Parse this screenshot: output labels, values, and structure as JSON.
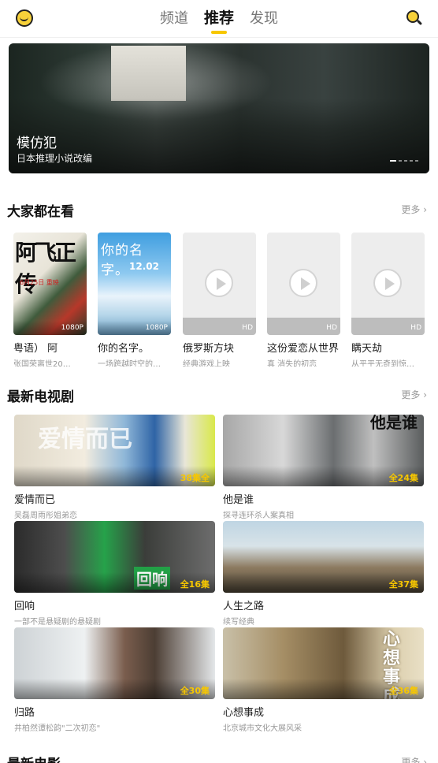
{
  "topbar": {
    "tabs": [
      "频道",
      "推荐",
      "发现"
    ],
    "active_tab": 1,
    "logo_icon": "smiley-logo-icon",
    "search_icon": "search-icon"
  },
  "banner": {
    "title": "模仿犯",
    "subtitle": "日本推理小说改编",
    "slide_count": 5,
    "active_slide": 0
  },
  "section_watching": {
    "title": "大家都在看",
    "more": "更多"
  },
  "movies": [
    {
      "name": "粤语）    阿",
      "desc": "张国荣离世20…",
      "badge": "1080P",
      "poster_text": "阿飞正传",
      "poster_small": "6月25日 重映"
    },
    {
      "name": "你的名字。",
      "desc": "一场跨越时空的…",
      "badge": "1080P",
      "poster_text": "你的名字。",
      "poster_small": "12.02"
    },
    {
      "name": "俄罗斯方块",
      "desc": "经典游戏上映",
      "badge": "HD"
    },
    {
      "name": "这份爱恋从世界",
      "desc": "真 消失的初恋",
      "badge": "HD"
    },
    {
      "name": "瞒天劫",
      "desc": "从平平无奇到惊…",
      "badge": "HD"
    }
  ],
  "section_tv": {
    "title": "最新电视剧",
    "more": "更多"
  },
  "tv": [
    {
      "name": "爱情而已",
      "desc": "吴磊周雨彤姐弟恋",
      "episodes": "38集全",
      "art": "爱情而已"
    },
    {
      "name": "他是谁",
      "desc": "探寻连环杀人案真相",
      "episodes": "全24集",
      "art": "他是谁"
    },
    {
      "name": "回响",
      "desc": "一部不是悬疑剧的悬疑剧",
      "episodes": "全16集",
      "art": "回响"
    },
    {
      "name": "人生之路",
      "desc": "续写经典",
      "episodes": "全37集",
      "art": ""
    },
    {
      "name": "归路",
      "desc": "井柏然谭松韵\"二次初恋\"",
      "episodes": "全30集",
      "art": ""
    },
    {
      "name": "心想事成",
      "desc": "北京城市文化大展风采",
      "episodes": "全36集",
      "art": "心想事成"
    }
  ],
  "section_film": {
    "title": "最新电影",
    "more": "更多"
  }
}
